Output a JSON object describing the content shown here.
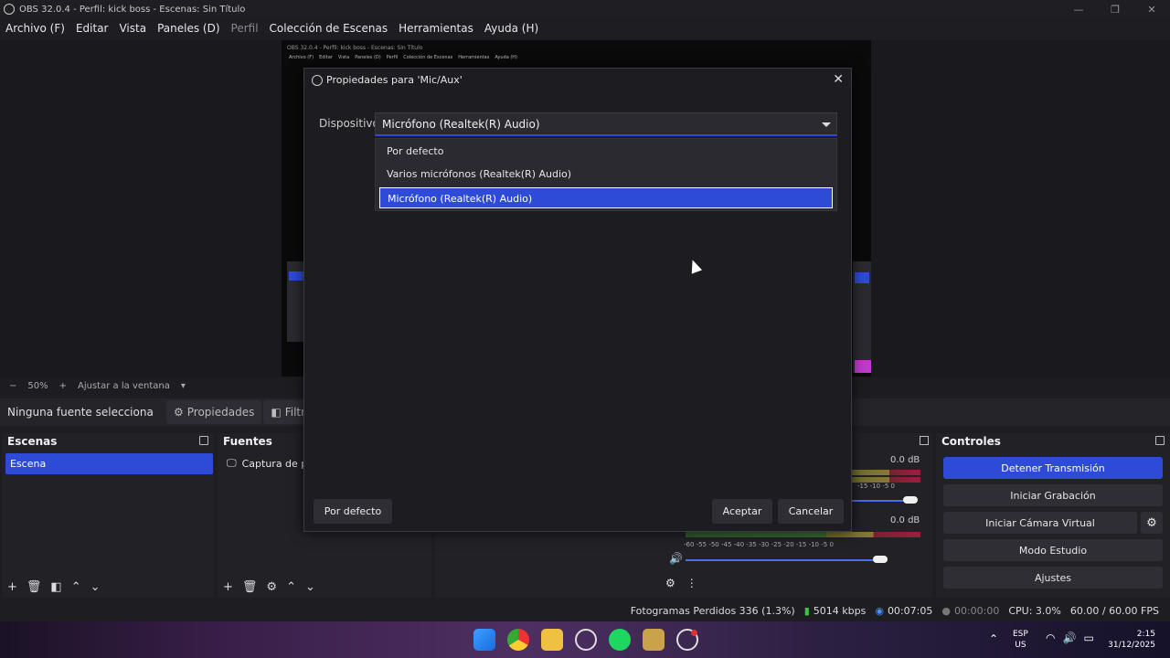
{
  "window": {
    "title": "OBS 32.0.4 - Perfil: kick boss - Escenas: Sin Título",
    "minimize_icon": "—",
    "maximize_icon": "❐",
    "close_icon": "✕"
  },
  "menu": [
    "Archivo (F)",
    "Editar",
    "Vista",
    "Paneles (D)",
    "Perfil",
    "Colección de Escenas",
    "Herramientas",
    "Ayuda (H)"
  ],
  "preview": {
    "inner_title": "OBS 32.0.4 - Perfil: kick boss - Escenas: Sin Título",
    "inner_menu": [
      "Archivo (F)",
      "Editar",
      "Vista",
      "Paneles (D)",
      "Perfil",
      "Colección de Escenas",
      "Herramientas",
      "Ayuda (H)"
    ],
    "zoom_minus": "−",
    "zoom": "50%",
    "zoom_plus": "+",
    "fit_label": "Ajustar a la ventana"
  },
  "source_bar": {
    "no_source": "Ninguna fuente selecciona",
    "properties": "Propiedades",
    "filters": "Filtr"
  },
  "docks": {
    "scenes": {
      "title": "Escenas",
      "items": [
        "Escena"
      ]
    },
    "sources": {
      "title": "Fuentes",
      "items": [
        "Captura de p"
      ]
    },
    "mixer": {
      "channels": [
        {
          "db": "0.0 dB",
          "ticks": "-15  -10   -5    0"
        },
        {
          "db": "0.0 dB",
          "ticks": "-60  -55  -50  -45  -40  -35  -30  -25  -20  -15  -10   -5    0"
        }
      ],
      "levels": [
        0.82,
        0.82
      ]
    },
    "controls": {
      "title": "Controles",
      "buttons": [
        "Detener Transmisión",
        "Iniciar Grabación",
        "Iniciar Cámara Virtual",
        "Modo Estudio",
        "Ajustes"
      ]
    }
  },
  "status": {
    "dropped": "Fotogramas Perdidos 336 (1.3%)",
    "bitrate": "5014 kbps",
    "stream_time": "00:07:05",
    "rec_time": "00:00:00",
    "cpu": "CPU: 3.0%",
    "fps": "60.00 / 60.00 FPS"
  },
  "taskbar": {
    "lang": "ESP",
    "region": "US",
    "time": "2:15",
    "date": "31/12/2025"
  },
  "dialog": {
    "title": "Propiedades para 'Mic/Aux'",
    "device_label": "Dispositivo",
    "device_value": "Micrófono (Realtek(R) Audio)",
    "options": [
      "Por defecto",
      "Varios micrófonos (Realtek(R) Audio)",
      "Micrófono (Realtek(R) Audio)"
    ],
    "selected_index": 2,
    "defaults_btn": "Por defecto",
    "ok_btn": "Aceptar",
    "cancel_btn": "Cancelar"
  },
  "colors": {
    "accent": "#2e4bd8",
    "bg": "#1e1e22"
  }
}
